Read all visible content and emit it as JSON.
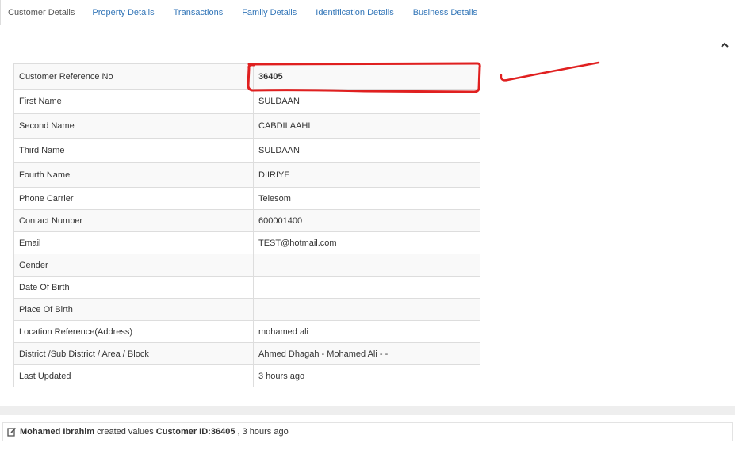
{
  "tabs": [
    {
      "label": "Customer Details",
      "active": true
    },
    {
      "label": "Property Details",
      "active": false
    },
    {
      "label": "Transactions",
      "active": false
    },
    {
      "label": "Family Details",
      "active": false
    },
    {
      "label": "Identification Details",
      "active": false
    },
    {
      "label": "Business Details",
      "active": false
    }
  ],
  "details": [
    {
      "label": "Customer Reference No",
      "value": "36405"
    },
    {
      "label": "First Name",
      "value": "SULDAAN"
    },
    {
      "label": "Second Name",
      "value": "CABDILAAHI"
    },
    {
      "label": "Third Name",
      "value": "SULDAAN"
    },
    {
      "label": "Fourth Name",
      "value": "DIIRIYE"
    },
    {
      "label": "Phone Carrier",
      "value": "Telesom"
    },
    {
      "label": "Contact Number",
      "value": "600001400"
    },
    {
      "label": "Email",
      "value": "TEST@hotmail.com"
    },
    {
      "label": "Gender",
      "value": ""
    },
    {
      "label": "Date Of Birth",
      "value": ""
    },
    {
      "label": "Place Of Birth",
      "value": ""
    },
    {
      "label": "Location Reference(Address)",
      "value": "mohamed ali"
    },
    {
      "label": "District /Sub District / Area / Block",
      "value": "Ahmed Dhagah - Mohamed Ali - -"
    },
    {
      "label": "Last Updated",
      "value": "3 hours ago"
    }
  ],
  "log": {
    "user": "Mohamed Ibrahim",
    "action": " created values ",
    "target": "Customer ID:36405",
    "time": " , 3 hours ago"
  },
  "colors": {
    "link": "#3376b8",
    "annotation": "#e02020",
    "border": "#dddddd"
  },
  "icons": {
    "collapse": "chevron-up-icon",
    "log": "edit-icon"
  }
}
